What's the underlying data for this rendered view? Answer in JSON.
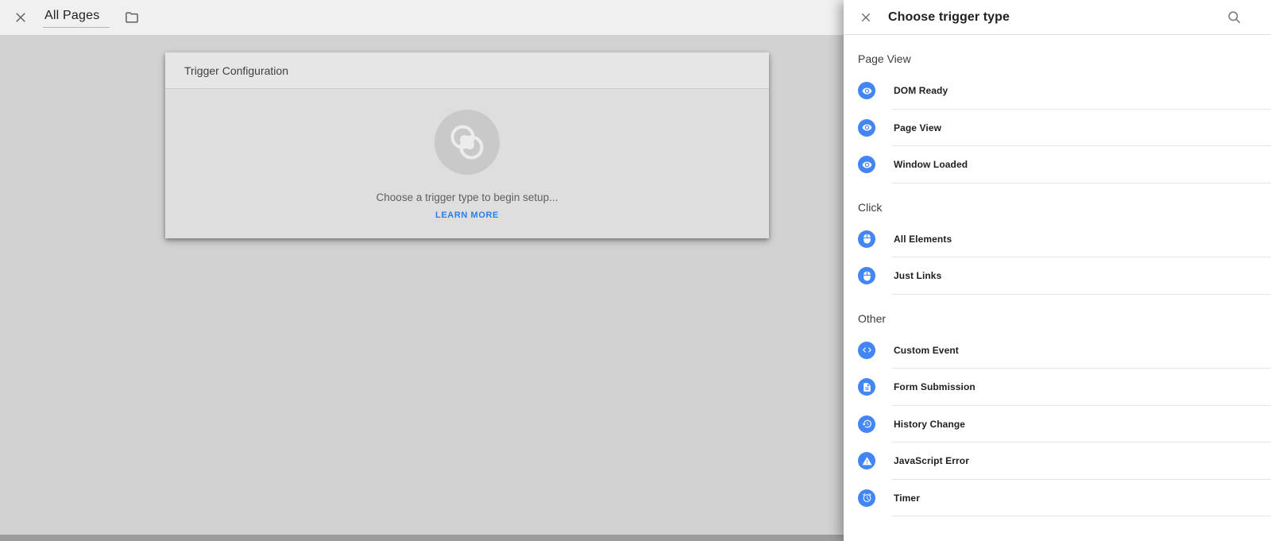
{
  "editor_bar": {
    "title": "All Pages",
    "close_icon": "close-icon",
    "folder_icon": "folder-icon"
  },
  "trigger_card": {
    "header": "Trigger Configuration",
    "placeholder_icon": "trigger-rings-icon",
    "placeholder_text": "Choose a trigger type to begin setup...",
    "learn_more_label": "LEARN MORE"
  },
  "panel": {
    "title": "Choose trigger type",
    "close_icon": "close-icon",
    "search_icon": "search-icon",
    "sections": [
      {
        "heading": "Page View",
        "items": [
          {
            "label": "DOM Ready",
            "icon": "eye-icon"
          },
          {
            "label": "Page View",
            "icon": "eye-icon"
          },
          {
            "label": "Window Loaded",
            "icon": "eye-icon"
          }
        ]
      },
      {
        "heading": "Click",
        "items": [
          {
            "label": "All Elements",
            "icon": "mouse-icon"
          },
          {
            "label": "Just Links",
            "icon": "mouse-icon"
          }
        ]
      },
      {
        "heading": "Other",
        "items": [
          {
            "label": "Custom Event",
            "icon": "code-icon"
          },
          {
            "label": "Form Submission",
            "icon": "form-icon"
          },
          {
            "label": "History Change",
            "icon": "history-icon"
          },
          {
            "label": "JavaScript Error",
            "icon": "warning-icon"
          },
          {
            "label": "Timer",
            "icon": "timer-icon"
          }
        ]
      }
    ]
  },
  "colors": {
    "icon_blue": "#4285f4",
    "link_blue": "#2b7de9",
    "panel_bg": "#ffffff",
    "page_bg": "#d2d2d2"
  }
}
